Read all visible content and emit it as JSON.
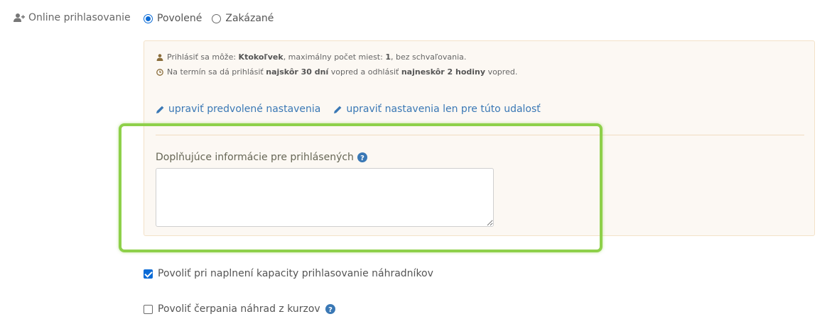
{
  "registration": {
    "label": "Online prihlasovanie",
    "options": [
      {
        "label": "Povolené",
        "selected": true
      },
      {
        "label": "Zakázané",
        "selected": false
      }
    ]
  },
  "info": {
    "line1_prefix": "Prihlásiť sa môže:",
    "line1_who": "Ktokoľvek",
    "line1_mid": ", maximálny počet miest:",
    "line1_count": "1",
    "line1_suffix": ", bez schvaľovania.",
    "line2_prefix": "Na termín sa dá prihlásiť",
    "line2_signup": "najskôr 30 dní",
    "line2_mid": "vopred a odhlásiť",
    "line2_signoff": "najneskôr 2 hodiny",
    "line2_suffix": "vopred."
  },
  "links": {
    "edit_default": "upraviť predvolené nastavenia",
    "edit_this": "upraviť nastavenia len pre túto udalosť"
  },
  "additional_info": {
    "label": "Doplňujúce informácie pre prihlásených",
    "value": ""
  },
  "options": {
    "substitutes_label": "Povoliť pri naplnení kapacity prihlasovanie náhradníkov",
    "substitutes_checked": true,
    "compensation_label": "Povoliť čerpania náhrad z kurzov",
    "compensation_checked": false
  },
  "colors": {
    "accent": "#0b6bd6",
    "link": "#3a78b5",
    "highlight": "#8ed04a",
    "panel_bg": "#fcf8f3"
  }
}
